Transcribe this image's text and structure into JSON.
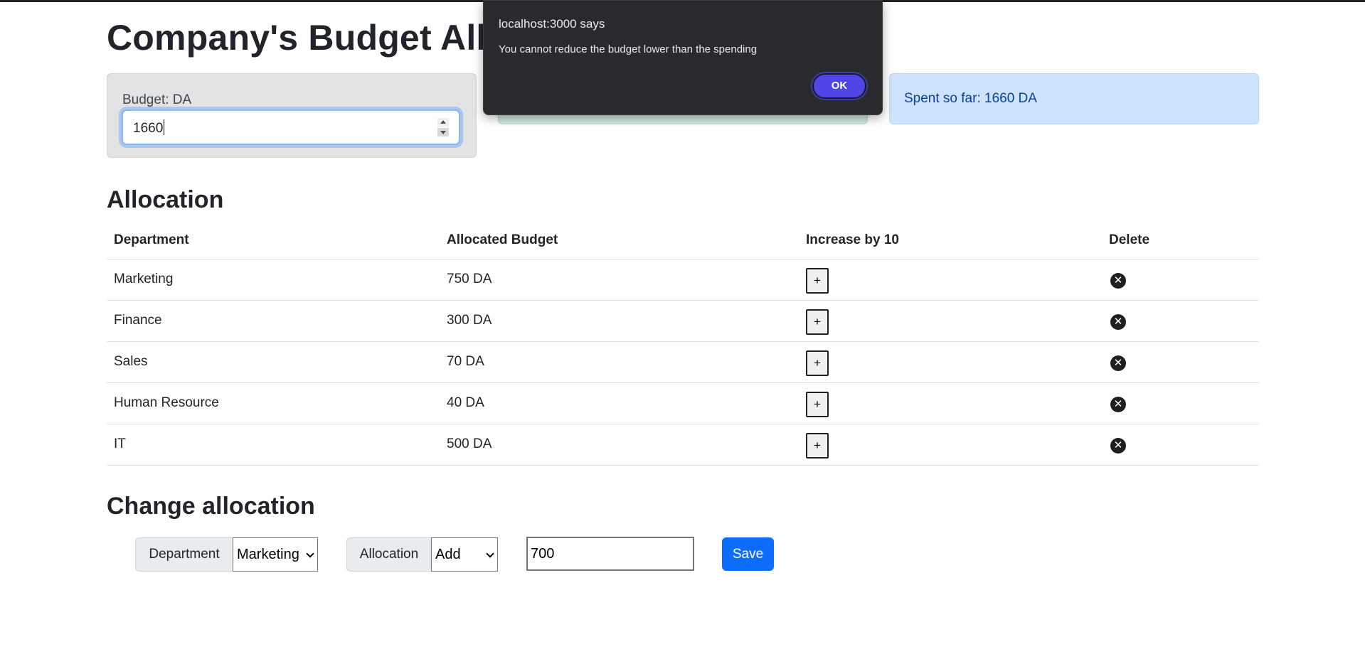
{
  "title": "Company's Budget Allocation",
  "budget": {
    "label": "Budget: DA",
    "value": "1660"
  },
  "spent": {
    "text": "Spent so far: 1660 DA"
  },
  "allocation": {
    "title": "Allocation",
    "headers": [
      "Department",
      "Allocated Budget",
      "Increase by 10",
      "Delete"
    ],
    "rows": [
      {
        "department": "Marketing",
        "budget": "750 DA"
      },
      {
        "department": "Finance",
        "budget": "300 DA"
      },
      {
        "department": "Sales",
        "budget": "70 DA"
      },
      {
        "department": "Human Resource",
        "budget": "40 DA"
      },
      {
        "department": "IT",
        "budget": "500 DA"
      }
    ],
    "increase_symbol": "+",
    "delete_symbol": "✕"
  },
  "change_allocation": {
    "title": "Change allocation",
    "department_label": "Department",
    "department_value": "Marketing",
    "allocation_label": "Allocation",
    "allocation_value": "Add",
    "amount_value": "700",
    "save_label": "Save"
  },
  "alert": {
    "title": "localhost:3000 says",
    "message": "You cannot reduce the budget lower than the spending",
    "ok_label": "OK"
  },
  "colors": {
    "primary": "#0d6efd",
    "dialog_bg": "#292a2d",
    "ok_button": "#4f46e5"
  }
}
